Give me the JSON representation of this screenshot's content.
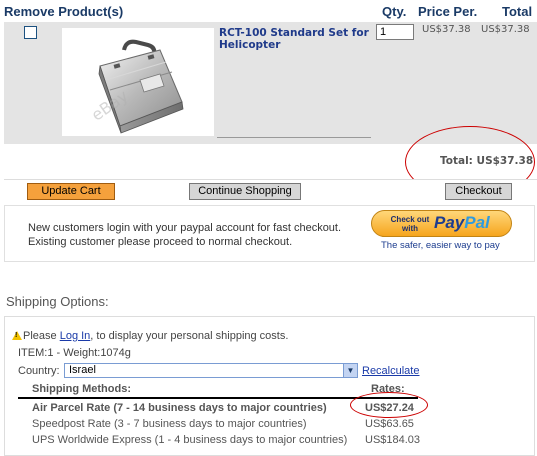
{
  "header": {
    "remove": "Remove Product(s)",
    "qty": "Qty.",
    "price_per": "Price Per.",
    "total": "Total"
  },
  "product": {
    "name": "RCT-100 Standard Set for Helicopter",
    "quantity": "1",
    "price_per": "US$37.38",
    "total": "US$37.38",
    "image_watermark": "eBay"
  },
  "cart_total": "Total:  US$37.38",
  "buttons": {
    "update_cart": "Update Cart",
    "continue_shopping": "Continue Shopping",
    "checkout": "Checkout"
  },
  "paypal": {
    "line1": "New customers login with your paypal account for fast checkout.",
    "line2": "Existing customer please proceed to normal checkout.",
    "checkout_with": "Check out with",
    "wordmark_pay": "Pay",
    "wordmark_pal": "Pal",
    "tagline": "The safer, easier way to pay"
  },
  "shipping": {
    "title": "Shipping Options:",
    "please_prefix": "Please ",
    "login_link": "Log In",
    "please_suffix": ", to display your personal shipping costs.",
    "item_line": "ITEM:1 - Weight:1074g",
    "country_label": "Country:",
    "country_value": "Israel",
    "recalculate": "Recalculate",
    "methods_header": "Shipping Methods:",
    "rates_header": "Rates:",
    "methods": [
      {
        "name": "Air Parcel Rate (7 - 14 business days to major countries)",
        "rate": "US$27.24"
      },
      {
        "name": "Speedpost Rate (3 - 7 business days to major countries)",
        "rate": "US$63.65"
      },
      {
        "name": "UPS Worldwide Express (1 - 4 business days to major countries)",
        "rate": "US$184.03"
      }
    ]
  },
  "colors": {
    "accent_orange": "#f5a13c",
    "heading_blue": "#1a3a66",
    "annotation_red": "#cc0000"
  }
}
